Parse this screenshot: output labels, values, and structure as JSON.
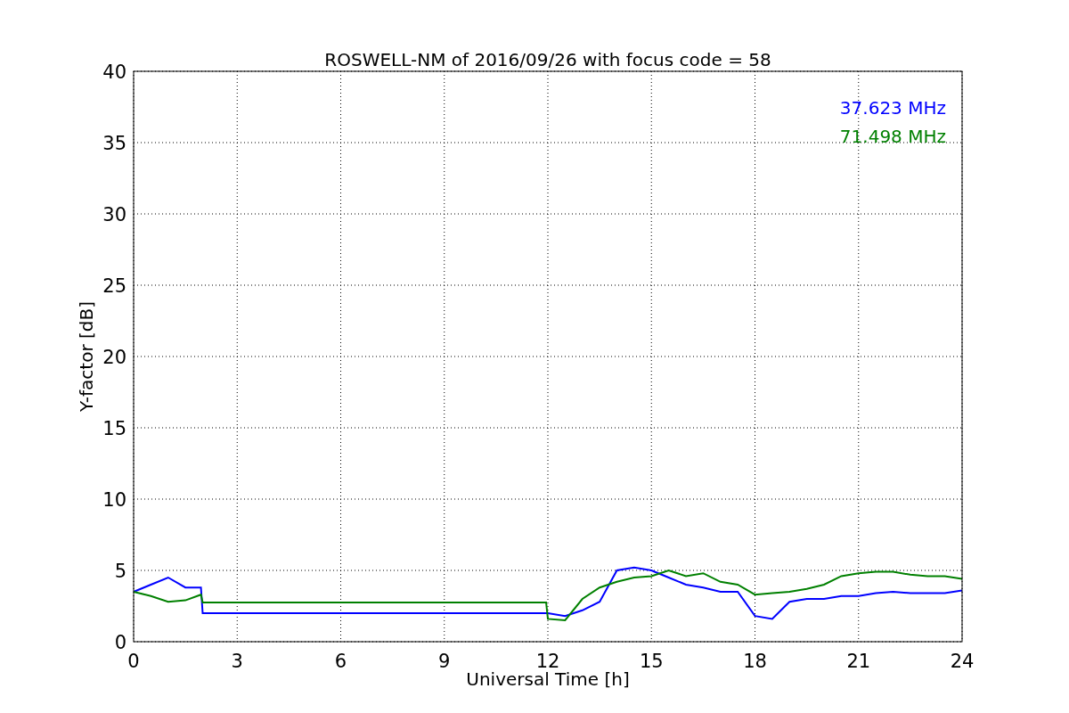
{
  "chart": {
    "chart_data": {
      "type": "line",
      "title": "ROSWELL-NM of 2016/09/26 with focus code = 58",
      "xlabel": "Universal Time [h]",
      "ylabel": "Y-factor [dB]",
      "x": [
        0,
        0.5,
        1,
        1.5,
        1.95,
        2,
        3,
        6,
        9,
        11.95,
        12,
        12.5,
        13,
        13.5,
        14,
        14.5,
        15,
        15.5,
        16,
        16.5,
        17,
        17.5,
        18,
        18.5,
        19,
        19.5,
        20,
        20.5,
        21,
        21.5,
        22,
        22.5,
        23,
        23.5,
        24
      ],
      "series": [
        {
          "name": "37.623 MHz",
          "color": "#0000ff",
          "values": [
            3.5,
            4.0,
            4.5,
            3.8,
            3.8,
            2.0,
            2.0,
            2.0,
            2.0,
            2.0,
            2.0,
            1.8,
            2.2,
            2.8,
            5.0,
            5.2,
            5.0,
            4.5,
            4.0,
            3.8,
            3.5,
            3.5,
            1.8,
            1.6,
            2.8,
            3.0,
            3.0,
            3.2,
            3.2,
            3.4,
            3.5,
            3.4,
            3.4,
            3.4,
            3.6
          ]
        },
        {
          "name": "71.498 MHz",
          "color": "#008000",
          "values": [
            3.5,
            3.2,
            2.8,
            2.9,
            3.3,
            2.75,
            2.75,
            2.75,
            2.75,
            2.75,
            1.6,
            1.5,
            3.0,
            3.8,
            4.2,
            4.5,
            4.6,
            5.0,
            4.6,
            4.8,
            4.2,
            4.0,
            3.3,
            3.4,
            3.5,
            3.7,
            4.0,
            4.6,
            4.8,
            4.9,
            4.9,
            4.7,
            4.6,
            4.6,
            4.4
          ]
        }
      ],
      "grid": true,
      "xlim": [
        0,
        24
      ],
      "ylim": [
        0,
        40
      ],
      "xticks": [
        0,
        3,
        6,
        9,
        12,
        15,
        18,
        21,
        24
      ],
      "yticks": [
        0,
        5,
        10,
        15,
        20,
        25,
        30,
        35,
        40
      ]
    }
  }
}
